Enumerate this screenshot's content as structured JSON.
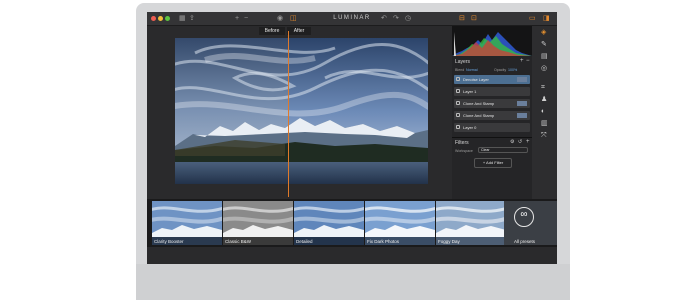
{
  "app": {
    "title": "LUMINAR"
  },
  "compare": {
    "before": "Before",
    "after": "After"
  },
  "layers": {
    "title": "Layers",
    "blend_label": "Blend",
    "blend_value": "Normal",
    "opacity_label": "Opacity",
    "opacity_value": "100%",
    "items": [
      {
        "label": "Denoise Layer",
        "active": true
      },
      {
        "label": "Layer 1",
        "active": false
      },
      {
        "label": "Clone And Stamp",
        "active": false
      },
      {
        "label": "Clone And Stamp",
        "active": false
      },
      {
        "label": "Layer 0",
        "active": false
      }
    ]
  },
  "filters": {
    "title": "Filters",
    "workspace_label": "Workspace",
    "workspace_value": "Clear",
    "add_filter": "+ Add Filter"
  },
  "presets": {
    "items": [
      {
        "label": "Clarity Booster"
      },
      {
        "label": "Classic B&W"
      },
      {
        "label": "Detailed"
      },
      {
        "label": "Fix Dark Photos"
      },
      {
        "label": "Foggy Day"
      }
    ],
    "all_presets": "All presets",
    "all_icon": "∞"
  },
  "icons": {
    "window_controls": [
      "close-dot",
      "minimize-dot",
      "maximize-dot"
    ],
    "toolbar": [
      "grid-icon",
      "share-icon",
      "eye-icon",
      "compare-icon",
      "undo-icon",
      "redo-icon",
      "history-icon",
      "split-view-icon",
      "crop-icon",
      "layout-icon",
      "panel-icon"
    ],
    "right_tools": [
      "palette-icon",
      "brush-icon",
      "layers-icon",
      "target-icon",
      "crop-tool-icon",
      "stamp-icon",
      "erase-icon",
      "gradient-icon",
      "transform-icon"
    ]
  },
  "colors": {
    "accent": "#e07a2a",
    "active_layer": "#4c6f92",
    "window_bg": "#2a2a2c"
  }
}
